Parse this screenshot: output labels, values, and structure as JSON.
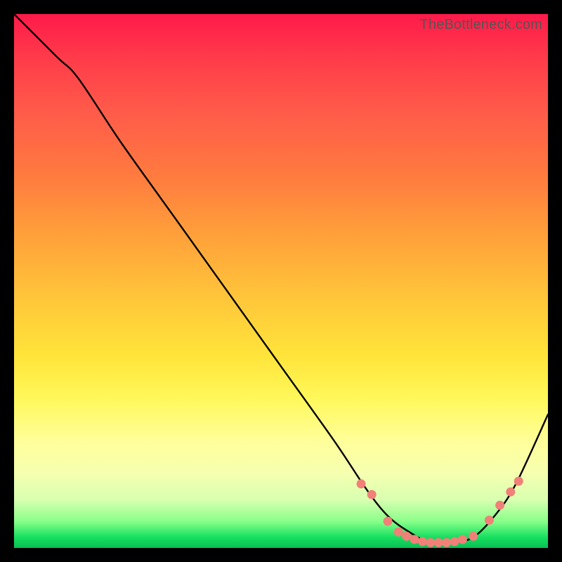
{
  "watermark": "TheBottleneck.com",
  "chart_data": {
    "type": "line",
    "title": "",
    "xlabel": "",
    "ylabel": "",
    "xlim": [
      0,
      100
    ],
    "ylim": [
      0,
      100
    ],
    "series": [
      {
        "name": "curve",
        "x": [
          0,
          8,
          12,
          20,
          30,
          40,
          50,
          60,
          66,
          70,
          74,
          78,
          82,
          86,
          90,
          94,
          100
        ],
        "y": [
          100,
          92,
          88,
          76,
          62,
          48,
          34,
          20,
          11,
          6,
          3,
          1,
          1,
          2,
          6,
          12,
          25
        ]
      }
    ],
    "markers": {
      "name": "dots",
      "color": "#f08078",
      "x": [
        65,
        67,
        70,
        72,
        73.5,
        75,
        76.5,
        78,
        79.5,
        81,
        82.5,
        84,
        86,
        89,
        91,
        93,
        94.5
      ],
      "y": [
        12,
        10,
        5,
        3,
        2.2,
        1.6,
        1.2,
        1.0,
        1.0,
        1.0,
        1.2,
        1.6,
        2.2,
        5.2,
        8.0,
        10.5,
        12.5
      ]
    }
  }
}
